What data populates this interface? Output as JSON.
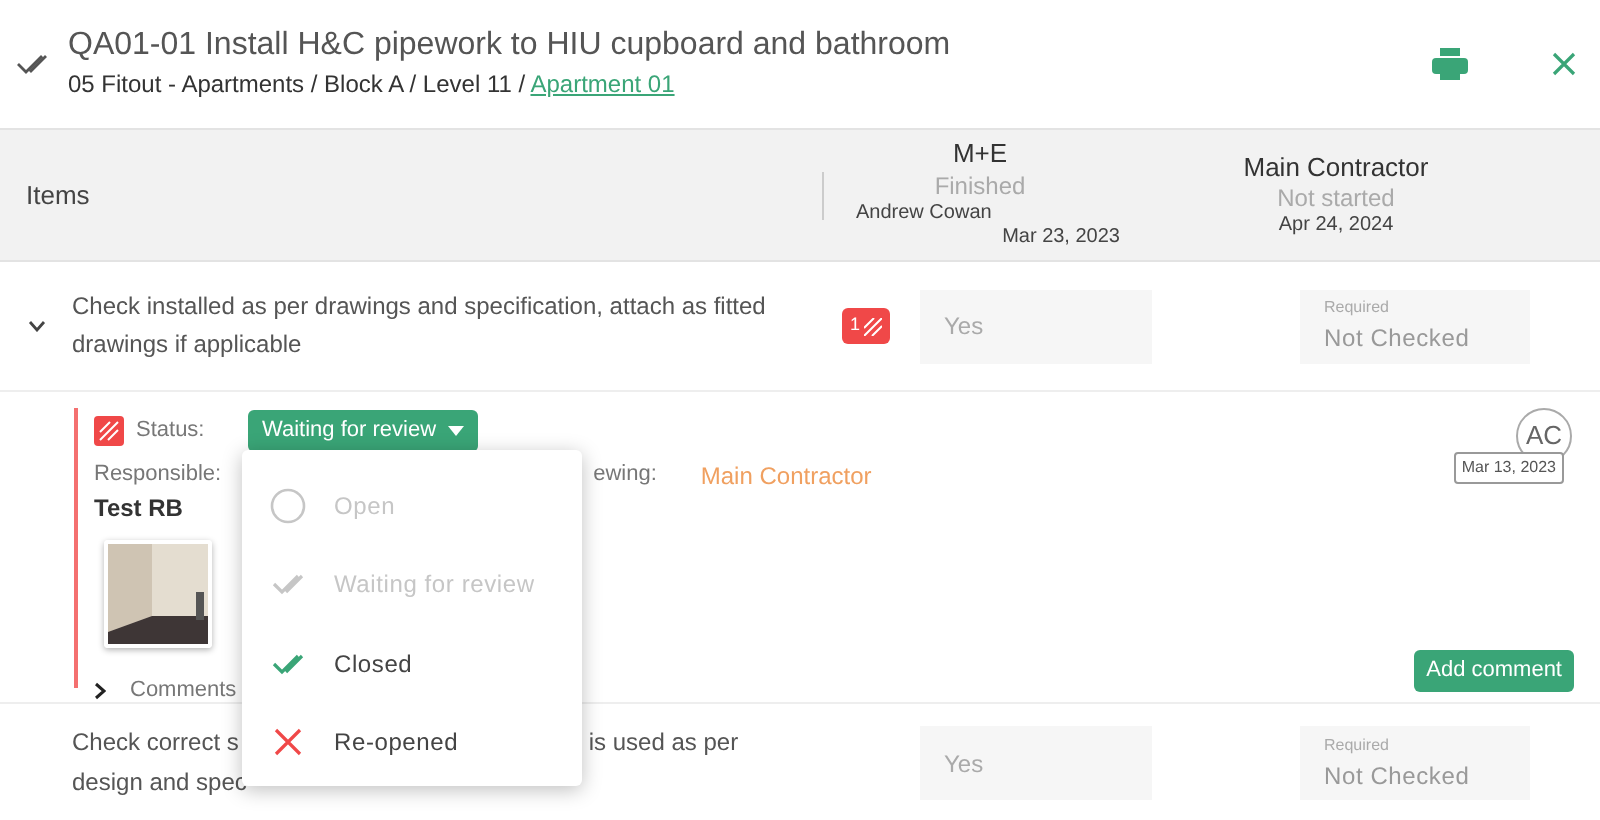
{
  "header": {
    "title": "QA01-01 Install H&C pipework to HIU cupboard and bathroom",
    "breadcrumb": "05 Fitout - Apartments / Block A / Level 11 /",
    "breadcrumb_link": "Apartment 01"
  },
  "columns_header": {
    "items_label": "Items",
    "stages": [
      {
        "name": "M+E",
        "status": "Finished",
        "person": "Andrew Cowan",
        "date": "Mar 23, 2023"
      },
      {
        "name": "Main Contractor",
        "status": "Not started",
        "date": "Apr 24, 2024"
      }
    ]
  },
  "items": [
    {
      "text": "Check installed as per drawings and specification, attach as fitted drawings if applicable",
      "expanded": true,
      "issue_count": "1",
      "answer": "Yes",
      "required_label": "Required",
      "required_value": "Not Checked"
    },
    {
      "text_before": "Check correct s",
      "text_after": "is used as per",
      "text_line2": "design and spec",
      "answer": "Yes",
      "required_label": "Required",
      "required_value": "Not Checked"
    }
  ],
  "detail": {
    "status_label": "Status:",
    "status_value": "Waiting for review",
    "responsible_label": "Responsible:",
    "responsible": "Test RB",
    "reviewing_label": "ewing:",
    "reviewing": "Main Contractor",
    "avatar": "AC",
    "date": "Mar 13, 2023",
    "comments_label": "Comments",
    "add_comment": "Add comment"
  },
  "status_menu": [
    {
      "label": "Open",
      "kind": "circle",
      "disabled": true
    },
    {
      "label": "Waiting for review",
      "kind": "check",
      "disabled": true
    },
    {
      "label": "Closed",
      "kind": "check",
      "disabled": false
    },
    {
      "label": "Re-opened",
      "kind": "cross",
      "disabled": false
    }
  ]
}
